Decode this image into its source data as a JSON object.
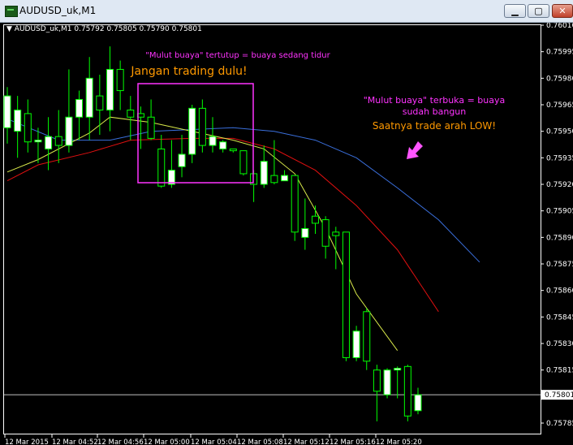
{
  "window": {
    "title": "AUDUSD_uk,M1",
    "minimize_label": "▁",
    "maximize_label": "▢",
    "close_label": "✕"
  },
  "colors": {
    "background": "#000000",
    "bull_candle": "#ffffff",
    "bear_candle": "#000000",
    "candle_wick": "#00ff00",
    "grid_axis": "#ffffff",
    "jaw": "#3a6fdc",
    "teeth": "#e01010",
    "lips": "#d8e84a",
    "annotation_box": "#ff33ff",
    "annotation_title": "#ff33ff",
    "annotation_note": "#ff9900",
    "arrow": "#ff55ff"
  },
  "chart_header": {
    "symbol": "AUDUSD_uk,M1",
    "open": "0.75792",
    "high": "0.75805",
    "low": "0.75790",
    "close": "0.75801"
  },
  "annotations": {
    "sleep_title": "\"Mulut buaya\" tertutup = buaya sedang tidur",
    "sleep_note": "Jangan trading dulu!",
    "wake_title_line1": "\"Mulut buaya\" terbuka = buaya",
    "wake_title_line2": "sudah bangun",
    "wake_note": "Saatnya  trade arah LOW!"
  },
  "chart_data": {
    "type": "candlestick",
    "title": "AUDUSD_uk,M1",
    "ylim": [
      0.75772,
      0.76013
    ],
    "y_ticks": [
      "0.76010",
      "0.75995",
      "0.75980",
      "0.75965",
      "0.75950",
      "0.75935",
      "0.75920",
      "0.75905",
      "0.75890",
      "0.75875",
      "0.75860",
      "0.75845",
      "0.75830",
      "0.75815",
      "0.75801",
      "0.75785"
    ],
    "x_tick_labels": [
      "12 Mar 2015",
      "12 Mar 04:52",
      "12 Mar 04:56",
      "12 Mar 05:00",
      "12 Mar 05:04",
      "12 Mar 05:08",
      "12 Mar 05:12",
      "12 Mar 05:16",
      "12 Mar 05:20"
    ],
    "current_price": "0.75801",
    "candles": [
      {
        "o": 0.75952,
        "h": 0.75975,
        "l": 0.75943,
        "c": 0.7597
      },
      {
        "o": 0.7595,
        "h": 0.7597,
        "l": 0.75935,
        "c": 0.75962
      },
      {
        "o": 0.7596,
        "h": 0.75968,
        "l": 0.75938,
        "c": 0.75944
      },
      {
        "o": 0.75944,
        "h": 0.75952,
        "l": 0.75932,
        "c": 0.75945
      },
      {
        "o": 0.7594,
        "h": 0.75958,
        "l": 0.75928,
        "c": 0.75947
      },
      {
        "o": 0.75947,
        "h": 0.75962,
        "l": 0.75932,
        "c": 0.75942
      },
      {
        "o": 0.75942,
        "h": 0.75985,
        "l": 0.75938,
        "c": 0.75958
      },
      {
        "o": 0.75958,
        "h": 0.75973,
        "l": 0.75945,
        "c": 0.75968
      },
      {
        "o": 0.75958,
        "h": 0.75992,
        "l": 0.75945,
        "c": 0.7598
      },
      {
        "o": 0.7597,
        "h": 0.75982,
        "l": 0.75948,
        "c": 0.75962
      },
      {
        "o": 0.75962,
        "h": 0.75998,
        "l": 0.7595,
        "c": 0.75985
      },
      {
        "o": 0.75985,
        "h": 0.7599,
        "l": 0.75962,
        "c": 0.75973
      },
      {
        "o": 0.75962,
        "h": 0.7597,
        "l": 0.75945,
        "c": 0.75958
      },
      {
        "o": 0.7596,
        "h": 0.75964,
        "l": 0.7594,
        "c": 0.75958
      },
      {
        "o": 0.75958,
        "h": 0.75968,
        "l": 0.75945,
        "c": 0.75946
      },
      {
        "o": 0.7594,
        "h": 0.75948,
        "l": 0.75918,
        "c": 0.75919
      },
      {
        "o": 0.7592,
        "h": 0.75945,
        "l": 0.75918,
        "c": 0.75928
      },
      {
        "o": 0.7593,
        "h": 0.75948,
        "l": 0.75924,
        "c": 0.75937
      },
      {
        "o": 0.75937,
        "h": 0.75965,
        "l": 0.75932,
        "c": 0.75963
      },
      {
        "o": 0.75963,
        "h": 0.75968,
        "l": 0.75938,
        "c": 0.75942
      },
      {
        "o": 0.75942,
        "h": 0.75958,
        "l": 0.75938,
        "c": 0.75947
      },
      {
        "o": 0.7594,
        "h": 0.75945,
        "l": 0.75938,
        "c": 0.75944
      },
      {
        "o": 0.7594,
        "h": 0.7594,
        "l": 0.75938,
        "c": 0.75939
      },
      {
        "o": 0.75939,
        "h": 0.75939,
        "l": 0.75925,
        "c": 0.75926
      },
      {
        "o": 0.75926,
        "h": 0.75928,
        "l": 0.7591,
        "c": 0.7592
      },
      {
        "o": 0.7592,
        "h": 0.75942,
        "l": 0.75918,
        "c": 0.75933
      },
      {
        "o": 0.75925,
        "h": 0.75945,
        "l": 0.7592,
        "c": 0.75921
      },
      {
        "o": 0.75922,
        "h": 0.75928,
        "l": 0.75922,
        "c": 0.75925
      },
      {
        "o": 0.75925,
        "h": 0.75925,
        "l": 0.75888,
        "c": 0.75893
      },
      {
        "o": 0.7589,
        "h": 0.75912,
        "l": 0.75883,
        "c": 0.75895
      },
      {
        "o": 0.75902,
        "h": 0.75908,
        "l": 0.75892,
        "c": 0.75898
      },
      {
        "o": 0.759,
        "h": 0.75902,
        "l": 0.75878,
        "c": 0.75885
      },
      {
        "o": 0.75893,
        "h": 0.75896,
        "l": 0.75872,
        "c": 0.75891
      },
      {
        "o": 0.75893,
        "h": 0.75893,
        "l": 0.7582,
        "c": 0.75822
      },
      {
        "o": 0.75822,
        "h": 0.7584,
        "l": 0.7582,
        "c": 0.75837
      },
      {
        "o": 0.75848,
        "h": 0.7585,
        "l": 0.75815,
        "c": 0.7582
      },
      {
        "o": 0.75815,
        "h": 0.75818,
        "l": 0.75786,
        "c": 0.75803
      },
      {
        "o": 0.75801,
        "h": 0.75816,
        "l": 0.75799,
        "c": 0.75815
      },
      {
        "o": 0.75815,
        "h": 0.75817,
        "l": 0.75799,
        "c": 0.75816
      },
      {
        "o": 0.75817,
        "h": 0.75818,
        "l": 0.75786,
        "c": 0.75789
      },
      {
        "o": 0.75792,
        "h": 0.75805,
        "l": 0.7579,
        "c": 0.75801
      }
    ],
    "alligator": {
      "jaw": [
        {
          "i": 0,
          "v": 0.75957
        },
        {
          "i": 5,
          "v": 0.75945
        },
        {
          "i": 10,
          "v": 0.75945
        },
        {
          "i": 14,
          "v": 0.7595
        },
        {
          "i": 18,
          "v": 0.75951
        },
        {
          "i": 22,
          "v": 0.75952
        },
        {
          "i": 26,
          "v": 0.7595
        },
        {
          "i": 30,
          "v": 0.75945
        },
        {
          "i": 34,
          "v": 0.75935
        },
        {
          "i": 38,
          "v": 0.75918
        },
        {
          "i": 42,
          "v": 0.759
        },
        {
          "i": 46,
          "v": 0.75876
        }
      ],
      "teeth": [
        {
          "i": 0,
          "v": 0.75922
        },
        {
          "i": 3,
          "v": 0.75931
        },
        {
          "i": 8,
          "v": 0.75938
        },
        {
          "i": 12,
          "v": 0.75945
        },
        {
          "i": 18,
          "v": 0.75946
        },
        {
          "i": 22,
          "v": 0.75946
        },
        {
          "i": 26,
          "v": 0.7594
        },
        {
          "i": 30,
          "v": 0.75928
        },
        {
          "i": 34,
          "v": 0.75908
        },
        {
          "i": 38,
          "v": 0.75883
        },
        {
          "i": 42,
          "v": 0.75848
        }
      ],
      "lips": [
        {
          "i": 0,
          "v": 0.75927
        },
        {
          "i": 3,
          "v": 0.75934
        },
        {
          "i": 8,
          "v": 0.75949
        },
        {
          "i": 10,
          "v": 0.75958
        },
        {
          "i": 14,
          "v": 0.75955
        },
        {
          "i": 18,
          "v": 0.7595
        },
        {
          "i": 22,
          "v": 0.75945
        },
        {
          "i": 25,
          "v": 0.7594
        },
        {
          "i": 28,
          "v": 0.75926
        },
        {
          "i": 31,
          "v": 0.75895
        },
        {
          "i": 34,
          "v": 0.75858
        },
        {
          "i": 38,
          "v": 0.75826
        }
      ]
    }
  }
}
